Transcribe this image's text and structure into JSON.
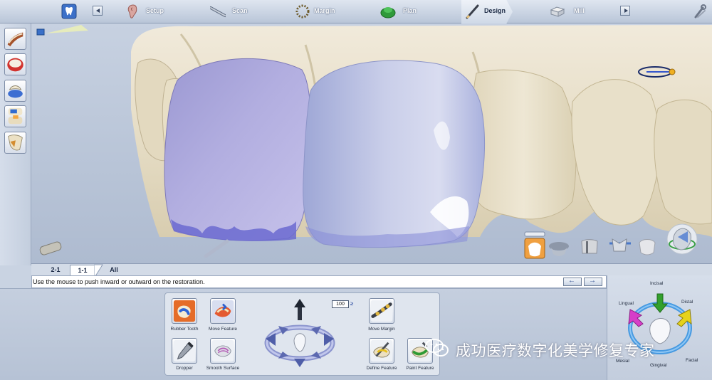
{
  "workflow": {
    "steps": [
      {
        "label": "Setup",
        "icon": "ear-icon"
      },
      {
        "label": "Scan",
        "icon": "scan-wand-icon"
      },
      {
        "label": "Margin",
        "icon": "margin-ring-icon"
      },
      {
        "label": "Plan",
        "icon": "plan-gum-icon"
      },
      {
        "label": "Design",
        "icon": "design-pencil-icon"
      },
      {
        "label": "Mill",
        "icon": "mill-block-icon"
      }
    ],
    "active_step": "Design"
  },
  "tabs": [
    {
      "label": "2-1"
    },
    {
      "label": "1-1"
    },
    {
      "label": "All"
    }
  ],
  "active_tab": "1-1",
  "status": {
    "message": "Use the mouse to push inward or outward on the restoration."
  },
  "tools": {
    "rubber_tooth": "Rubber Tooth",
    "move_feature": "Move Feature",
    "move_margin": "Move Margin",
    "dropper": "Dropper",
    "smooth_surface": "Smooth Surface",
    "define_feature": "Define Feature",
    "paint_feature": "Paint Feature",
    "strength_value": "100",
    "strength_unit": "≥"
  },
  "orientation": {
    "incisal": "Incisal",
    "lingual": "Lingual",
    "distal": "Distal",
    "mesial": "Mesial",
    "gingival": "Gingival",
    "facial": "Facial"
  },
  "watermark": {
    "text": "成功医疗数字化美学修复专家"
  },
  "colors": {
    "restoration_lilac": "#a9a5d9",
    "restoration_blue": "#b4bde0",
    "tooth_bone": "#e8dfc6",
    "accent_orange": "#f0a040",
    "arrow_green": "#33a02c",
    "arrow_magenta": "#d63ec8",
    "arrow_yellow": "#e6d21a",
    "ring_blue": "#2f8fe0"
  }
}
